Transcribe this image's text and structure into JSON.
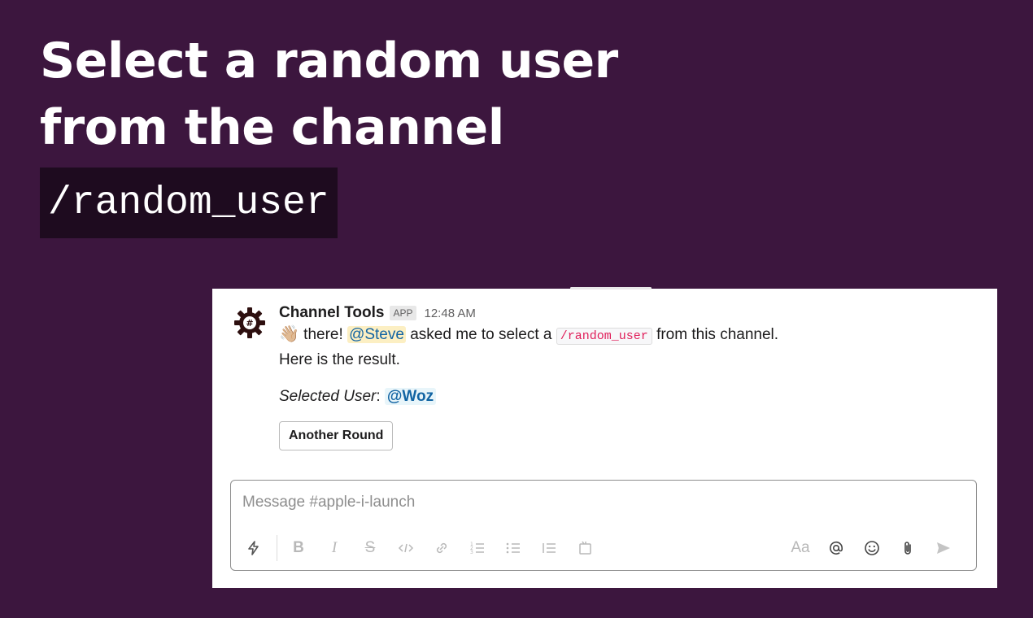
{
  "headline": {
    "line1": "Select a random user",
    "line2": "from the channel"
  },
  "command": "/random_user",
  "message": {
    "sender": "Channel Tools",
    "badge": "APP",
    "time": "12:48 AM",
    "wave_emoji": "👋🏼",
    "text_there": " there! ",
    "mention_requester": "@Steve",
    "text_asked": " asked me to select a ",
    "inline_code": "/random_user",
    "text_from": " from this channel.",
    "line2": "Here is the result.",
    "selected_label": "Selected User",
    "selected_colon": ": ",
    "selected_user": "@Woz",
    "button_label": "Another Round"
  },
  "composer": {
    "placeholder": "Message #apple-i-launch",
    "format_buttons": [
      "B",
      "I",
      "S"
    ],
    "text_size_label": "Aa",
    "icons": [
      "shortcuts-icon",
      "bold-icon",
      "italic-icon",
      "strikethrough-icon",
      "code-icon",
      "link-icon",
      "ordered-list-icon",
      "bulleted-list-icon",
      "blockquote-icon",
      "code-block-icon",
      "text-format-icon",
      "mention-icon",
      "emoji-icon",
      "attach-icon",
      "send-icon"
    ]
  },
  "colors": {
    "background": "#3c163e",
    "command_box": "#1e0b1f",
    "mention_bg": "#fcefc3",
    "link": "#1264a3",
    "code": "#e01e5a"
  }
}
